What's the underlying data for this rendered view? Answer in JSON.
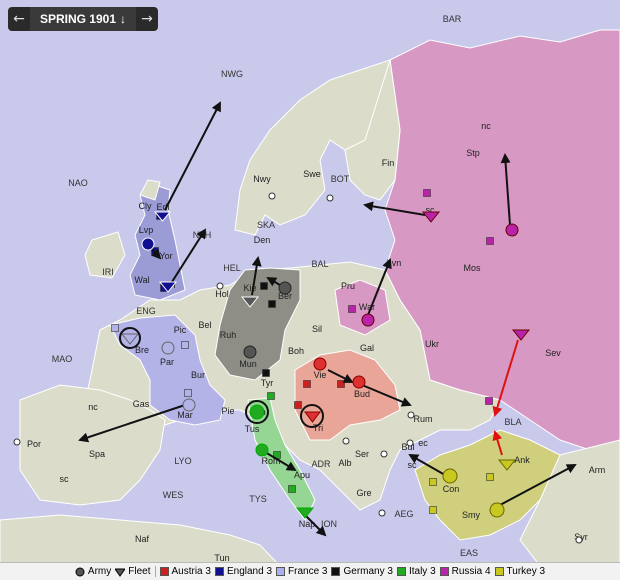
{
  "turn": {
    "label": "SPRING 1901",
    "dropdown_icon": "arrow-down-icon",
    "prev_icon": "arrow-left-icon",
    "next_icon": "arrow-right-icon"
  },
  "colors": {
    "sea": "#c9c9ec",
    "land": "#dcdccb",
    "border": "#ffffff",
    "ocean_line": "#a8a8d8",
    "Austria": "#e8a598",
    "England": "#9b9bd6",
    "France": "#b3b3e8",
    "Germany": "#8e8e86",
    "Italy": "#95d695",
    "Russia": "#d799c3",
    "Turkey": "#cfcf7e"
  },
  "legend": {
    "army": "Army",
    "fleet": "Fleet",
    "powers": [
      {
        "name": "Austria",
        "label": "Austria 3",
        "color": "#cc1f1f"
      },
      {
        "name": "England",
        "label": "England 3",
        "color": "#101090"
      },
      {
        "name": "France",
        "label": "France 3",
        "color": "#aab0ee"
      },
      {
        "name": "Germany",
        "label": "Germany 3",
        "color": "#111111"
      },
      {
        "name": "Italy",
        "label": "Italy 3",
        "color": "#22aa22"
      },
      {
        "name": "Russia",
        "label": "Russia 4",
        "color": "#bb22aa"
      },
      {
        "name": "Turkey",
        "label": "Turkey 3",
        "color": "#c8c820"
      }
    ]
  },
  "labels": {
    "BAR": "BAR",
    "NWG": "NWG",
    "NAO": "NAO",
    "nc": "nc",
    "Stp": "Stp",
    "Fin": "Fin",
    "Nwy": "Nwy",
    "Swe": "Swe",
    "BOT": "BOT",
    "sc_stp": "sc",
    "Cly": "Cly",
    "Edi": "Edi",
    "Lvp": "Lvp",
    "NTH": "NTH",
    "Yor": "Yor",
    "SKA": "SKA",
    "Den": "Den",
    "IRI": "IRI",
    "Wal": "Wal",
    "Lon": "Lon",
    "HEL": "HEL",
    "BAL": "BAL",
    "Lvn": "Lvn",
    "Mos": "Mos",
    "Hol": "Hol",
    "Kie": "Kie",
    "Ber": "Ber",
    "Pru": "Pru",
    "ENG": "ENG",
    "War": "War",
    "Pic": "Pic",
    "Bel": "Bel",
    "Ruh": "Ruh",
    "Sil": "Sil",
    "Bre": "Bre",
    "Par": "Par",
    "Mun": "Mun",
    "Boh": "Boh",
    "Gal": "Gal",
    "Ukr": "Ukr",
    "MAO": "MAO",
    "Sev": "Sev",
    "Bur": "Bur",
    "Tyr": "Tyr",
    "Vie": "Vie",
    "Bud": "Bud",
    "Gas": "Gas",
    "nc_spa": "nc",
    "Mar": "Mar",
    "Pie": "Pie",
    "Ven": "Ven",
    "Tri": "Tri",
    "Rum": "Rum",
    "BLA": "BLA",
    "Por": "Por",
    "Spa": "Spa",
    "Tus": "Tus",
    "Bul": "Bul",
    "ec": "ec",
    "Ank": "Ank",
    "Arm": "Arm",
    "sc_spa": "sc",
    "LYO": "LYO",
    "Rom": "Rom",
    "ADR": "ADR",
    "Ser": "Ser",
    "sc_bul": "sc",
    "Con": "Con",
    "Apu": "Apu",
    "Alb": "Alb",
    "WES": "WES",
    "TYS": "TYS",
    "Nap": "Nap",
    "Gre": "Gre",
    "Smy": "Smy",
    "AEG": "AEG",
    "Syr": "Syr",
    "ION": "ION",
    "Naf": "Naf",
    "Tun": "Tun",
    "EAS": "EAS"
  }
}
